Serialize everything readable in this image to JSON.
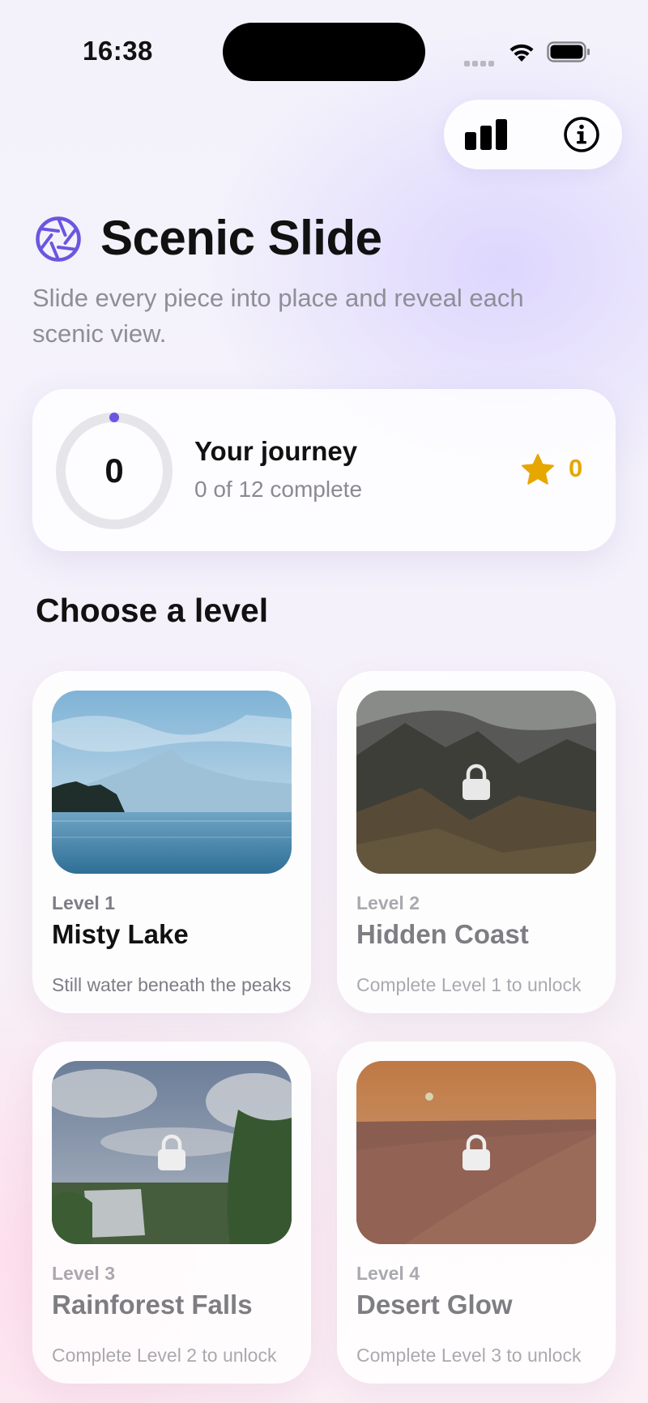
{
  "status_bar": {
    "time": "16:38"
  },
  "header": {
    "title": "Scenic Slide",
    "subtitle": "Slide every piece into place and reveal each scenic view."
  },
  "journey": {
    "progress_value": "0",
    "progress_fraction": 0,
    "title": "Your journey",
    "subtitle": "0 of 12 complete",
    "stars": "0"
  },
  "section": {
    "title": "Choose a level"
  },
  "levels": [
    {
      "number": "Level 1",
      "name": "Misty Lake",
      "desc": "Still water beneath the peaks",
      "locked": false
    },
    {
      "number": "Level 2",
      "name": "Hidden Coast",
      "desc": "Complete Level 1 to unlock",
      "locked": true
    },
    {
      "number": "Level 3",
      "name": "Rainforest Falls",
      "desc": "Complete Level 2 to unlock",
      "locked": true
    },
    {
      "number": "Level 4",
      "name": "Desert Glow",
      "desc": "Complete Level 3 to unlock",
      "locked": true
    }
  ],
  "icons": {
    "brand": "aperture-icon",
    "stats": "bar-chart-icon",
    "info": "info-icon",
    "star": "star-icon",
    "lock": "lock-icon"
  },
  "colors": {
    "accent": "#6a56e0",
    "star": "#e6a700"
  }
}
